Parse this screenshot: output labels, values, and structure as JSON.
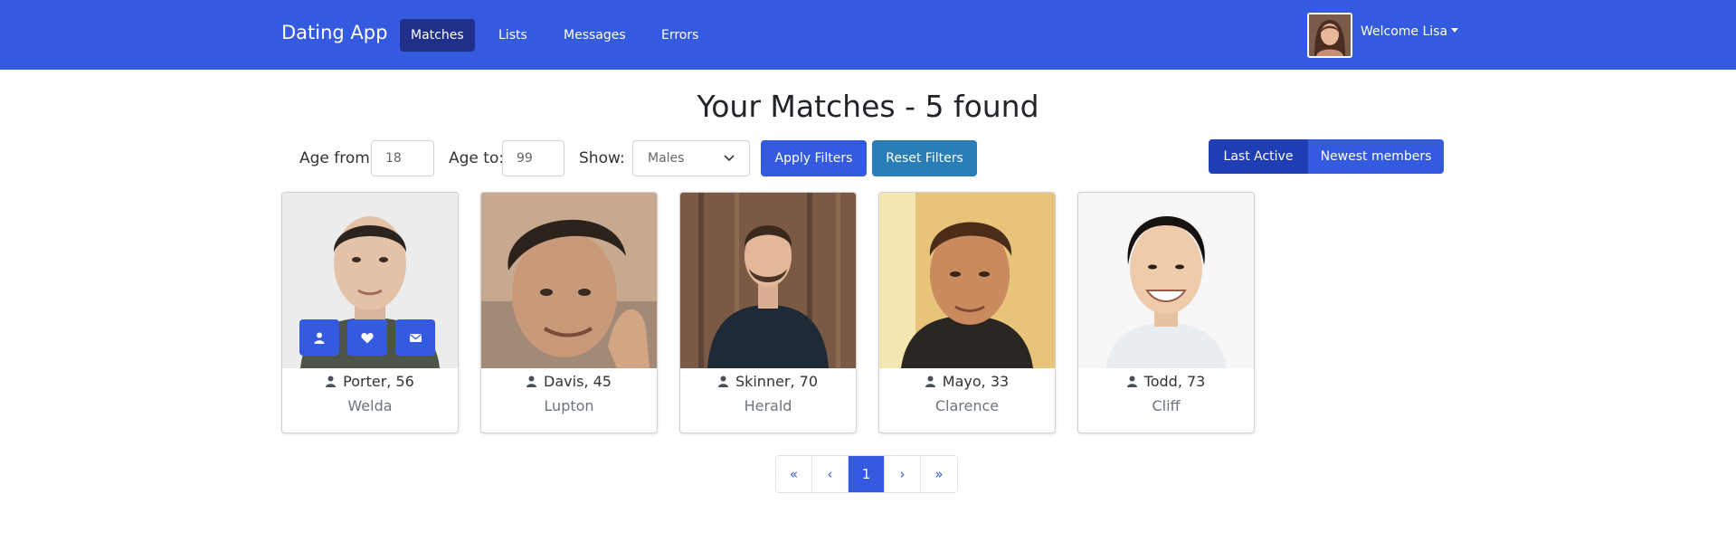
{
  "navbar": {
    "brand": "Dating App",
    "links": [
      {
        "label": "Matches",
        "active": true
      },
      {
        "label": "Lists",
        "active": false
      },
      {
        "label": "Messages",
        "active": false
      },
      {
        "label": "Errors",
        "active": false
      }
    ],
    "welcome": "Welcome Lisa"
  },
  "title": "Your Matches - 5 found",
  "filters": {
    "age_from_label": "Age from:",
    "age_from_value": "18",
    "age_to_label": "Age to:",
    "age_to_value": "99",
    "show_label": "Show:",
    "show_value": "Males",
    "apply_label": "Apply Filters",
    "reset_label": "Reset Filters"
  },
  "sort": {
    "last_active": "Last Active",
    "newest": "Newest members",
    "selected": "Last Active"
  },
  "members": [
    {
      "name": "Porter, 56",
      "city": "Welda"
    },
    {
      "name": "Davis, 45",
      "city": "Lupton"
    },
    {
      "name": "Skinner, 70",
      "city": "Herald"
    },
    {
      "name": "Mayo, 33",
      "city": "Clarence"
    },
    {
      "name": "Todd, 73",
      "city": "Cliff"
    }
  ],
  "pagination": {
    "first": "«",
    "prev": "‹",
    "current": "1",
    "next": "›",
    "last": "»"
  },
  "colors": {
    "primary": "#345ae0",
    "nav_active": "#1f2f8a",
    "reset_button": "#2a7eb8",
    "sort_active": "#1f3eb3"
  },
  "icons": {
    "card_actions": [
      "user-icon",
      "heart-icon",
      "envelope-icon"
    ],
    "name_prefix": "user-icon",
    "show_dropdown": "chevron-down-icon"
  }
}
